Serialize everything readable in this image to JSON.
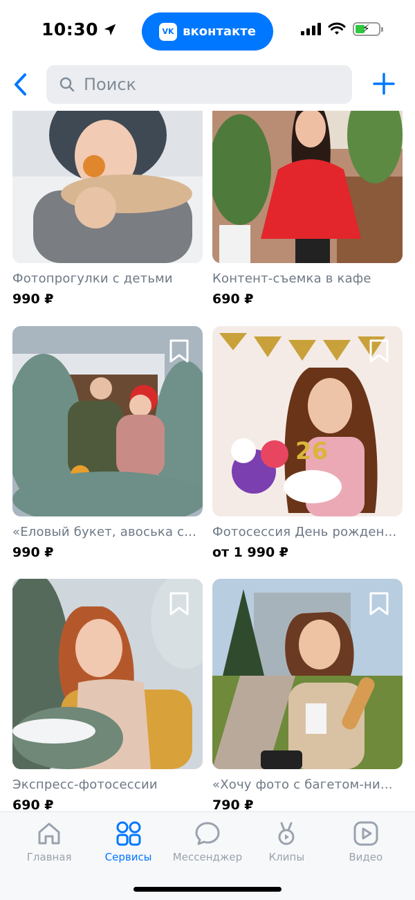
{
  "status": {
    "time": "10:30",
    "vk_label": "вконтакте",
    "vk_logo": "VK"
  },
  "search": {
    "placeholder": "Поиск"
  },
  "items": [
    {
      "title": "Фотопрогулки с детьми",
      "price": "990 ₽",
      "bookmark": false,
      "scene": "child-snow"
    },
    {
      "title": "Контент-съемка в кафе",
      "price": "690 ₽",
      "bookmark": false,
      "scene": "woman-red-cafe"
    },
    {
      "title": "«Еловый букет, авоська с...",
      "price": "990 ₽",
      "bookmark": true,
      "scene": "couple-fir"
    },
    {
      "title": "Фотосессия  День рожден...",
      "price": "от 1 990 ₽",
      "bookmark": true,
      "scene": "birthday-cake"
    },
    {
      "title": "Экспресс-фотосессии",
      "price": "690 ₽",
      "bookmark": true,
      "scene": "woman-winter-fir"
    },
    {
      "title": "«Хочу фото с багетом-ни...",
      "price": "790 ₽",
      "bookmark": true,
      "scene": "woman-baguette"
    }
  ],
  "tabs": [
    {
      "label": "Главная",
      "icon": "home-icon",
      "active": false
    },
    {
      "label": "Сервисы",
      "icon": "services-icon",
      "active": true
    },
    {
      "label": "Мессенджер",
      "icon": "messenger-icon",
      "active": false
    },
    {
      "label": "Клипы",
      "icon": "clips-icon",
      "active": false
    },
    {
      "label": "Видео",
      "icon": "video-icon",
      "active": false
    }
  ],
  "colors": {
    "accent": "#0077ff",
    "muted": "#99a2ad",
    "search_bg": "#ebedf0"
  }
}
